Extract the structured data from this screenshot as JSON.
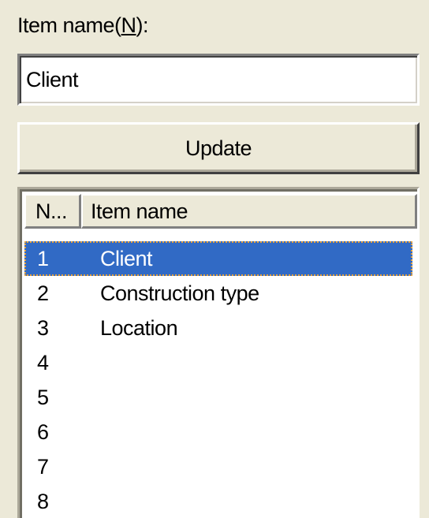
{
  "item_name_label": "Item name(",
  "item_name_mnemonic": "N",
  "item_name_label_end": "):",
  "item_name_value": "Client",
  "update_button": "Update",
  "list": {
    "headers": [
      "N...",
      "Item name"
    ],
    "rows": [
      {
        "num": "1",
        "name": "Client",
        "selected": true
      },
      {
        "num": "2",
        "name": "Construction type"
      },
      {
        "num": "3",
        "name": "Location"
      },
      {
        "num": "4",
        "name": ""
      },
      {
        "num": "5",
        "name": ""
      },
      {
        "num": "6",
        "name": ""
      },
      {
        "num": "7",
        "name": ""
      },
      {
        "num": "8",
        "name": ""
      }
    ]
  },
  "colors": {
    "face": "#ece9d8",
    "selection": "#316ac5",
    "focus_dots": "#e8a33c"
  }
}
